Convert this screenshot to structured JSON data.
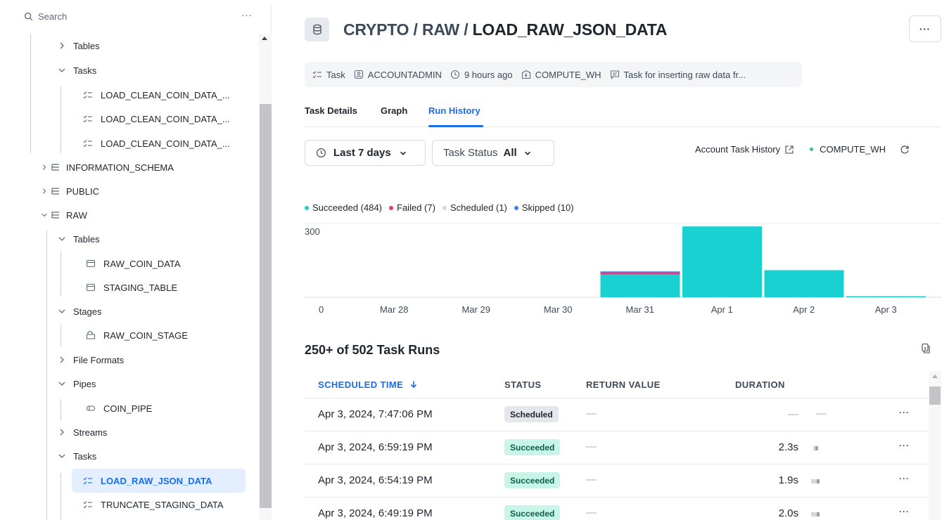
{
  "sidebar": {
    "search_placeholder": "Search",
    "more": "···",
    "tree": {
      "tables_1": "Tables",
      "tasks_1": "Tasks",
      "task_1a": "LOAD_CLEAN_COIN_DATA_...",
      "task_1b": "LOAD_CLEAN_COIN_DATA_...",
      "task_1c": "LOAD_CLEAN_COIN_DATA_...",
      "information_schema": "INFORMATION_SCHEMA",
      "public": "PUBLIC",
      "raw": "RAW",
      "tables_2": "Tables",
      "raw_coin_data": "RAW_COIN_DATA",
      "staging_table": "STAGING_TABLE",
      "stages": "Stages",
      "raw_coin_stage": "RAW_COIN_STAGE",
      "file_formats": "File Formats",
      "pipes": "Pipes",
      "coin_pipe": "COIN_PIPE",
      "streams": "Streams",
      "tasks_2": "Tasks",
      "load_raw_json_data": "LOAD_RAW_JSON_DATA",
      "truncate_staging_data": "TRUNCATE_STAGING_DATA"
    }
  },
  "header": {
    "path": "CRYPTO / RAW / ",
    "name": "LOAD_RAW_JSON_DATA",
    "more": "···"
  },
  "meta": {
    "type": "Task",
    "role": "ACCOUNTADMIN",
    "time": "9 hours ago",
    "warehouse": "COMPUTE_WH",
    "comment": "Task for inserting raw data fr..."
  },
  "tabs": [
    "Task Details",
    "Graph",
    "Run History"
  ],
  "filters": {
    "date_range": "Last 7 days",
    "status_label": "Task Status",
    "status_value": "All"
  },
  "tools": {
    "account_history": "Account Task History",
    "warehouse": "COMPUTE_WH"
  },
  "colors": {
    "succeeded": "#1ad1d1",
    "failed": "#f0367b",
    "scheduled": "#d4d8de",
    "skipped": "#3b82f6",
    "accent": "#1a6ce8"
  },
  "chart_data": {
    "type": "bar",
    "legend": [
      {
        "label": "Succeeded (484)",
        "color": "#1ad1d1"
      },
      {
        "label": "Failed (7)",
        "color": "#f0367b"
      },
      {
        "label": "Scheduled (1)",
        "color": "#d4d8de"
      },
      {
        "label": "Skipped (10)",
        "color": "#3b82f6"
      }
    ],
    "categories": [
      "Mar 28",
      "Mar 29",
      "Mar 30",
      "Mar 31",
      "Apr 1",
      "Apr 2",
      "Apr 3"
    ],
    "series": [
      {
        "name": "Succeeded",
        "values": [
          0,
          0,
          0,
          93,
          288,
          110,
          3
        ]
      },
      {
        "name": "Failed",
        "values": [
          0,
          0,
          0,
          7,
          0,
          0,
          0
        ]
      },
      {
        "name": "Skipped",
        "values": [
          0,
          0,
          0,
          5,
          0,
          0,
          0
        ]
      }
    ],
    "y_ticks": [
      "0",
      "300"
    ],
    "ylim": [
      0,
      300
    ]
  },
  "runs": {
    "title": "250+ of 502 Task Runs",
    "columns": [
      "SCHEDULED TIME",
      "STATUS",
      "RETURN VALUE",
      "DURATION"
    ],
    "rows": [
      {
        "time": "Apr 3, 2024, 7:47:06 PM",
        "status": "Scheduled",
        "return": "—",
        "duration": "—",
        "extra": "—"
      },
      {
        "time": "Apr 3, 2024, 6:59:19 PM",
        "status": "Succeeded",
        "return": "—",
        "duration": "2.3s"
      },
      {
        "time": "Apr 3, 2024, 6:54:19 PM",
        "status": "Succeeded",
        "return": "—",
        "duration": "1.9s"
      },
      {
        "time": "Apr 3, 2024, 6:49:19 PM",
        "status": "Succeeded",
        "return": "—",
        "duration": "2.0s"
      }
    ],
    "row_more": "···"
  }
}
